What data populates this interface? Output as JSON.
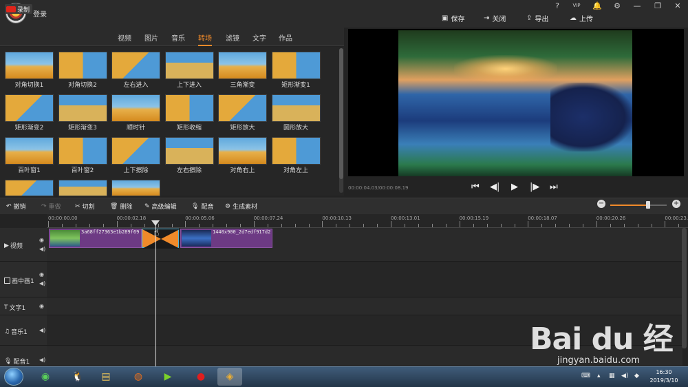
{
  "titlebar": {
    "login_label": "登录",
    "window_controls": [
      "?",
      "VIP",
      "🔔",
      "⚙",
      "—",
      "❐",
      "✕"
    ],
    "actions": [
      {
        "icon": "save-icon",
        "label": "保存"
      },
      {
        "icon": "close-doc-icon",
        "label": "关闭"
      },
      {
        "icon": "export-icon",
        "label": "导出"
      },
      {
        "icon": "upload-icon",
        "label": "上传"
      }
    ]
  },
  "tabs": {
    "record_label": "录制",
    "items": [
      "视频",
      "图片",
      "音乐",
      "转场",
      "滤镜",
      "文字",
      "作品"
    ],
    "active": "转场"
  },
  "transitions": [
    "对角切换1",
    "对角切换2",
    "左右进入",
    "上下进入",
    "三角渐变",
    "矩形渐变1",
    "矩形渐变2",
    "矩形渐变3",
    "顺时针",
    "矩形收缩",
    "矩形放大",
    "圆形放大",
    "百叶窗1",
    "百叶窗2",
    "上下擦除",
    "左右擦除",
    "对角右上",
    "对角左上",
    "",
    "",
    ""
  ],
  "preview": {
    "timecode": "00:00:04.03/00:00:08.19",
    "controls": [
      "⏮",
      "◀|",
      "▶",
      "|▶",
      "⏭"
    ]
  },
  "toolbar": {
    "undo": "撤销",
    "redo": "重做",
    "cut": "切割",
    "delete": "删除",
    "advanced_edit": "高级编辑",
    "dub": "配音",
    "generate": "生成素材",
    "zoom_level": 0.67
  },
  "ruler": [
    "00:00:00.00",
    "00:00:02.18",
    "00:00:05.06",
    "00:00:07.24",
    "00:00:10.13",
    "00:00:13.01",
    "00:00:15.19",
    "00:00:18.07",
    "00:00:20.26",
    "00:00:23."
  ],
  "tracks": [
    {
      "label": "视频",
      "icon": "video-track-icon"
    },
    {
      "label": "画中画1",
      "icon": "pip-track-icon"
    },
    {
      "label": "文字1",
      "icon": "text-track-icon"
    },
    {
      "label": "音乐1",
      "icon": "music-track-icon"
    },
    {
      "label": "配音1",
      "icon": "mic-track-icon"
    }
  ],
  "clips": {
    "clip1_name": "3a68ff27363e1b289f69",
    "clip2_name": "1440x900_2d7edf917d2"
  },
  "watermark": {
    "brand": "Bai du 经验",
    "url": "jingyan.baidu.com"
  },
  "taskbar": {
    "time": "16:30",
    "date": "2019/3/10"
  }
}
